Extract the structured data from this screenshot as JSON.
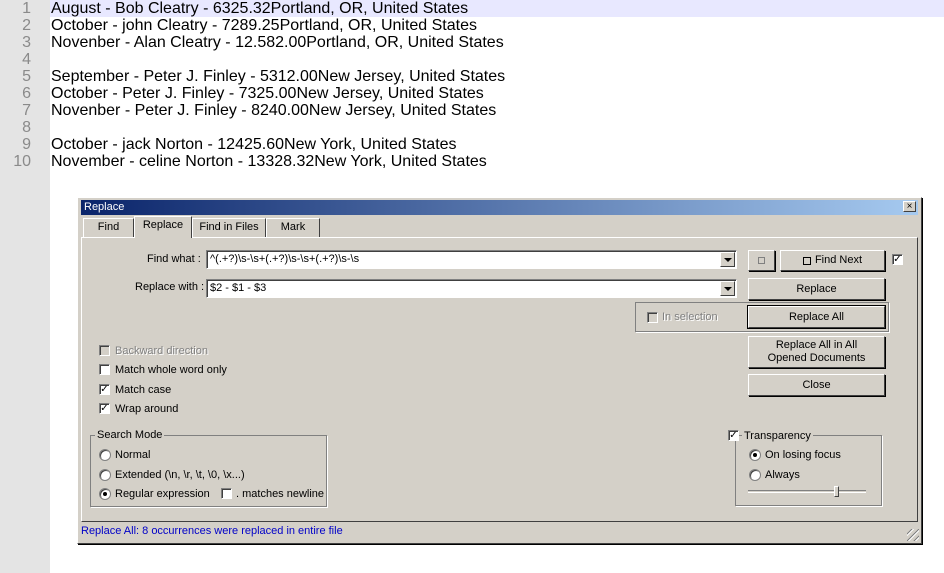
{
  "editor": {
    "line_numbers": [
      "1",
      "2",
      "3",
      "4",
      "5",
      "6",
      "7",
      "8",
      "9",
      "10"
    ],
    "lines": [
      "August - Bob Cleatry - 6325.32Portland, OR, United States",
      "October - john Cleatry - 7289.25Portland, OR, United States",
      "Novenber - Alan Cleatry - 12.582.00Portland, OR, United States",
      "",
      "September - Peter J. Finley - 5312.00New Jersey, United States",
      "October - Peter J. Finley - 7325.00New Jersey, United States",
      "Novenber - Peter J. Finley - 8240.00New Jersey, United States",
      "",
      "October - jack Norton - 12425.60New York, United States",
      "November - celine Norton - 13328.32New York, United States"
    ]
  },
  "dialog": {
    "title": "Replace",
    "close_glyph": "×",
    "tabs": [
      {
        "label": "Find"
      },
      {
        "label": "Replace"
      },
      {
        "label": "Find in Files"
      },
      {
        "label": "Mark"
      }
    ],
    "find_what_label": "Find what :",
    "find_what_value": "^(.+?)\\s-\\s+(.+?)\\s-\\s+(.+?)\\s-\\s",
    "replace_with_label": "Replace with :",
    "replace_with_value": "$2 - $1 - $3",
    "find_next_label": "Find Next",
    "replace_label": "Replace",
    "in_selection_label": "In selection",
    "replace_all_label": "Replace All",
    "replace_all_opened_line1": "Replace All in All",
    "replace_all_opened_line2": "Opened Documents",
    "close_label": "Close",
    "options": {
      "backward_direction": "Backward direction",
      "match_whole_word": "Match whole word only",
      "match_case": "Match case",
      "wrap_around": "Wrap around"
    },
    "search_mode": {
      "title": "Search Mode",
      "normal": "Normal",
      "extended": "Extended (\\n, \\r, \\t, \\0, \\x...)",
      "regex": "Regular expression",
      "matches_newline": ". matches newline"
    },
    "transparency": {
      "label": "Transparency",
      "on_losing_focus": "On losing focus",
      "always": "Always",
      "level_fraction": 0.75
    },
    "status": "Replace All: 8 occurrences were replaced in entire file"
  }
}
